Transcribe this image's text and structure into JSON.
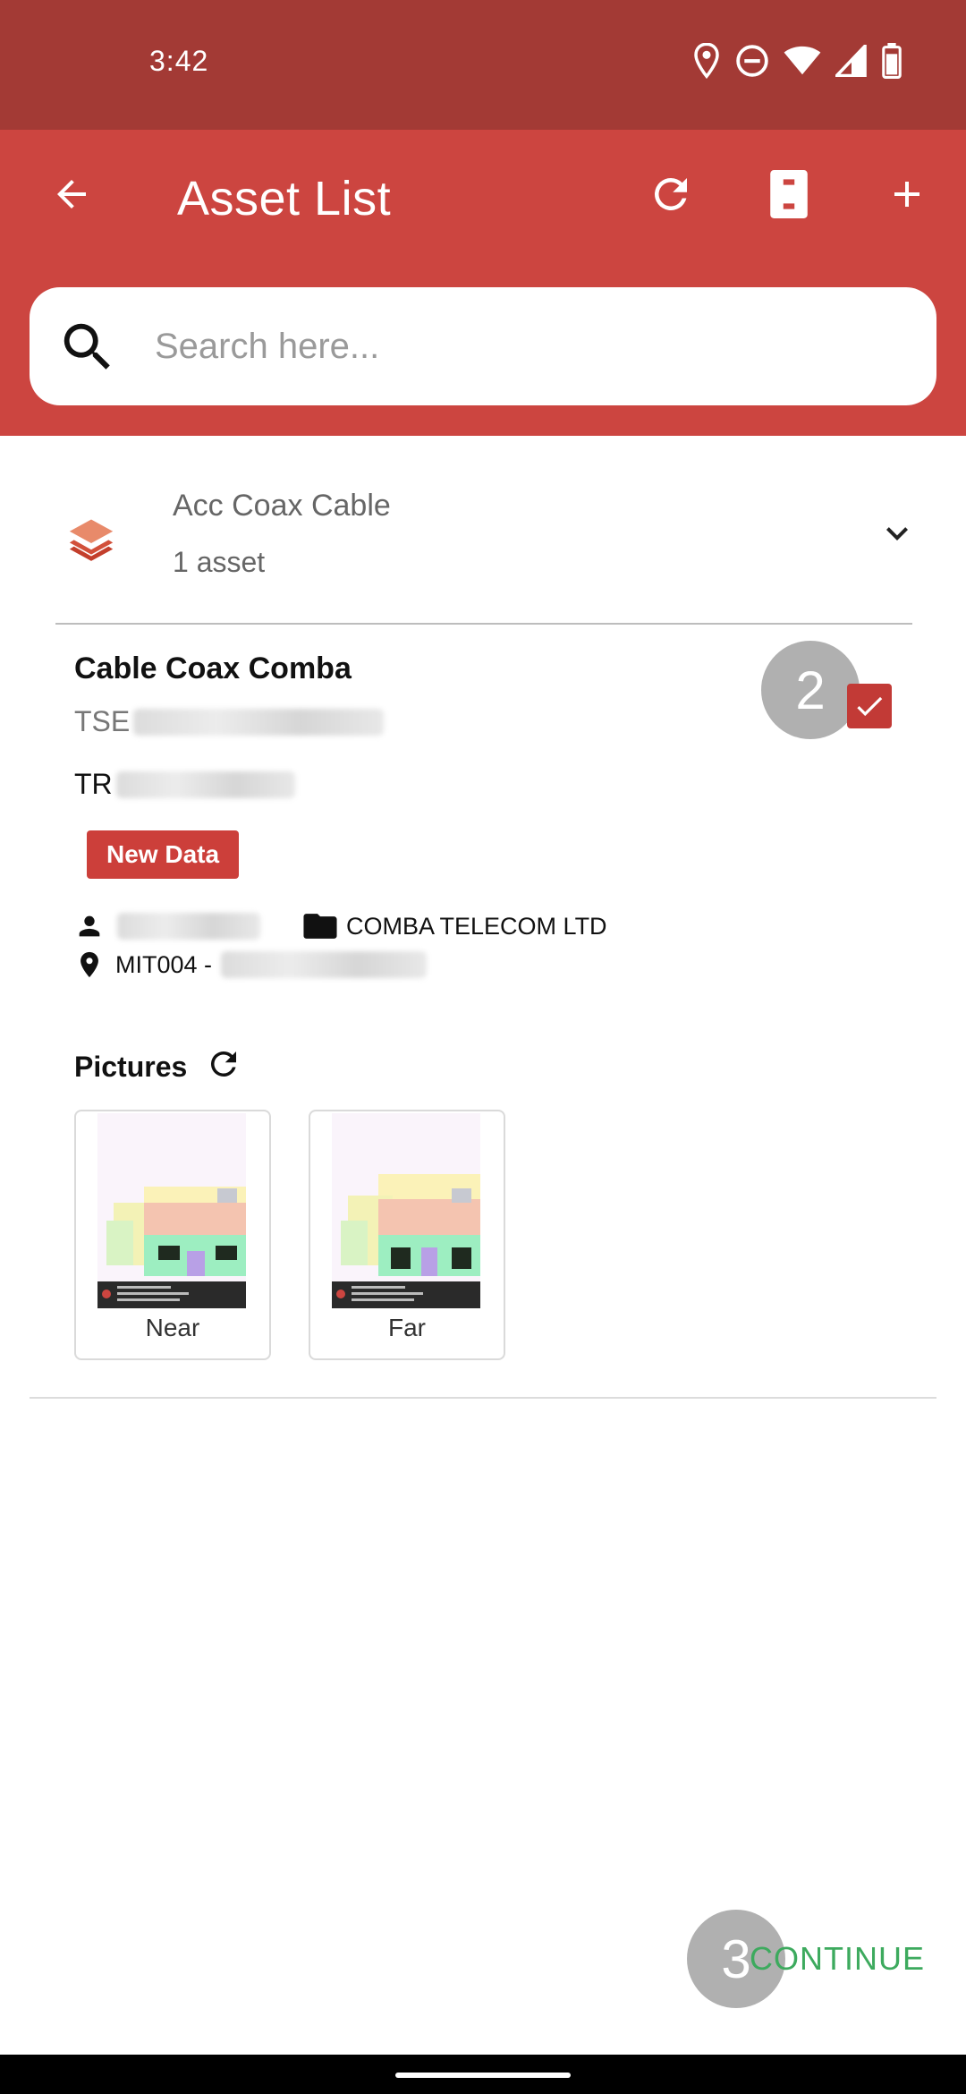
{
  "status_bar": {
    "time": "3:42",
    "icons": [
      "location-icon",
      "dnd-icon",
      "wifi-icon",
      "signal-icon",
      "battery-icon"
    ]
  },
  "app_bar": {
    "title": "Asset List",
    "actions": [
      "back-arrow-icon",
      "refresh-icon",
      "document-icon",
      "add-icon"
    ],
    "color": "#cc4540"
  },
  "search": {
    "placeholder": "Search here...",
    "value": ""
  },
  "group": {
    "title": "Acc Coax Cable",
    "count_label": "1 asset",
    "icon": "layers-icon"
  },
  "asset": {
    "title": "Cable Coax Comba",
    "code_prefix": "TSE",
    "code2_prefix": "TR",
    "badge": "New Data",
    "vendor": "COMBA TELECOM LTD",
    "site_prefix": "MIT004 -",
    "checked": true,
    "step_number": "2"
  },
  "pictures": {
    "label": "Pictures",
    "items": [
      {
        "label": "Near"
      },
      {
        "label": "Far"
      }
    ]
  },
  "footer": {
    "step_number": "3",
    "continue_label": "CONTINUE",
    "continue_color": "#3daa5e"
  }
}
